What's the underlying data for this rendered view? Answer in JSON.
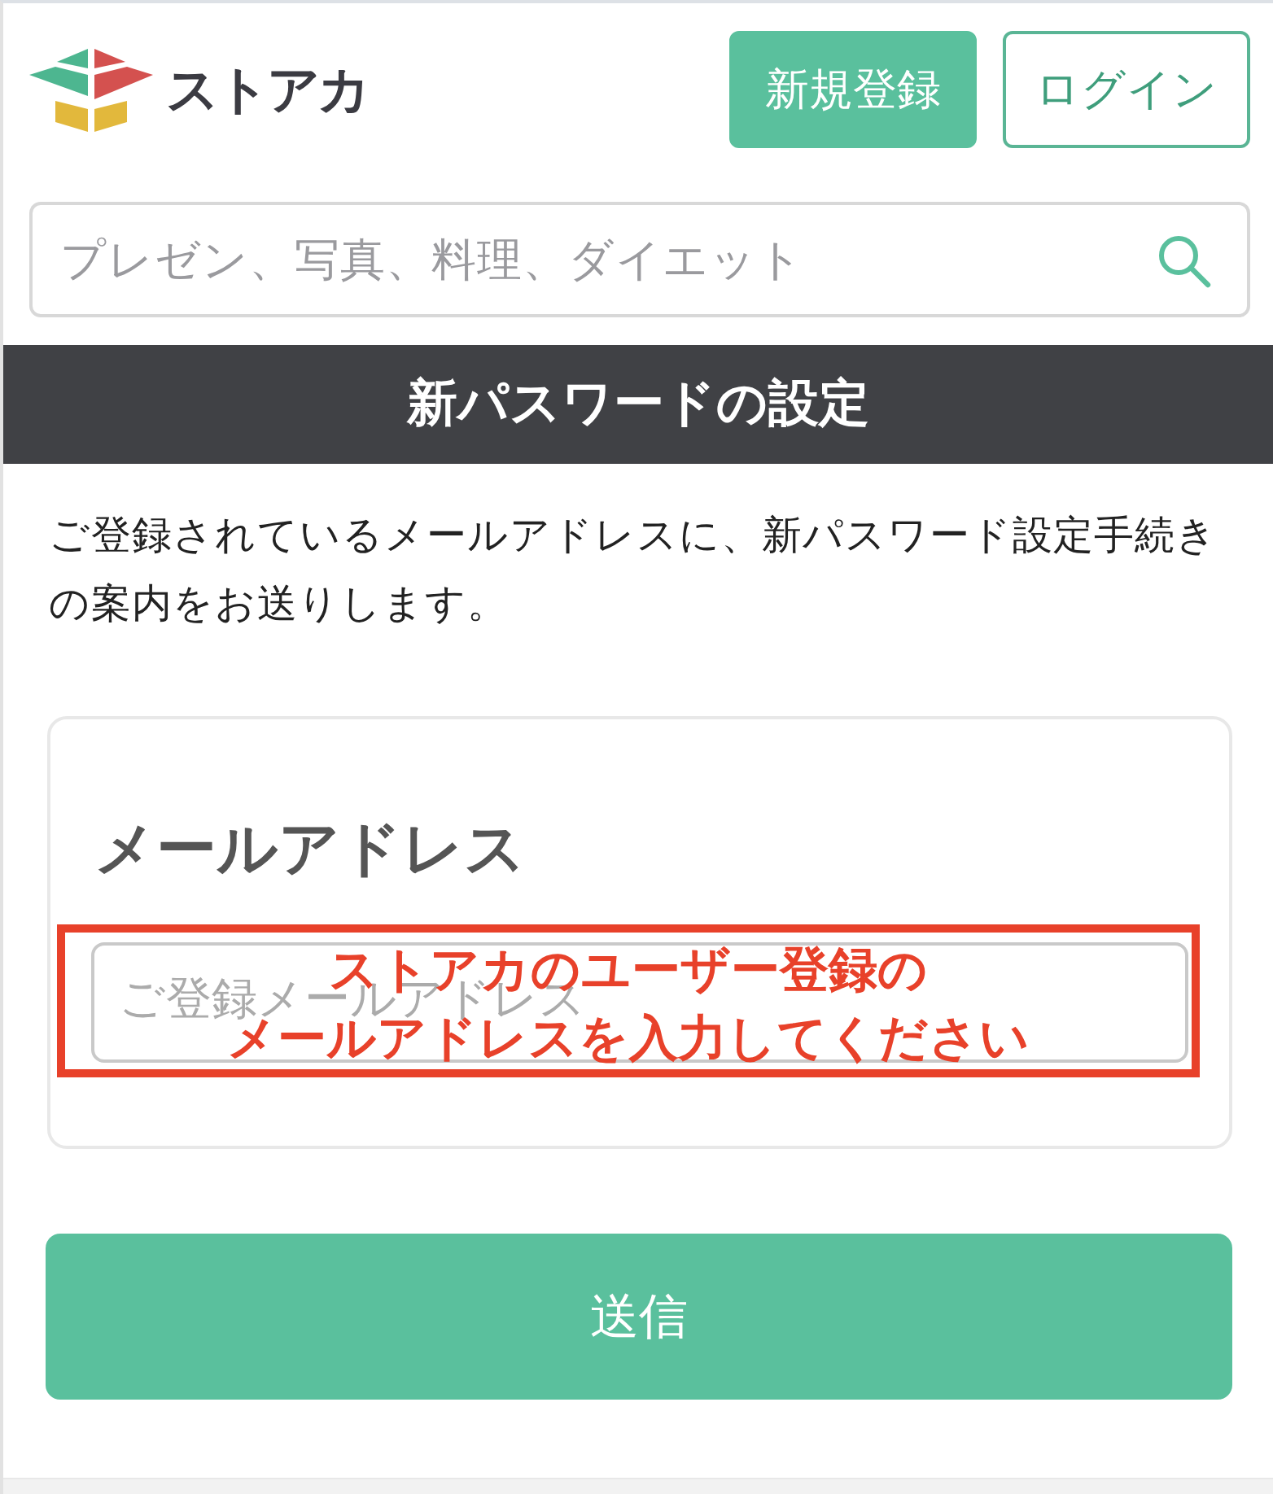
{
  "header": {
    "logo": {
      "text": "ストアカ"
    },
    "buttons": [
      {
        "label": "新規登録",
        "kind": "filled"
      },
      {
        "label": "ログイン",
        "kind": "outline"
      }
    ]
  },
  "search": {
    "placeholder": "プレゼン、写真、料理、ダイエット"
  },
  "page_title": "新パスワードの設定",
  "description": "ご登録されているメールアドレスに、新パスワード設定手続きの案内をお送りします。",
  "form": {
    "label": "メールアドレス",
    "email_field": {
      "placeholder": "ご登録メールアドレス"
    },
    "annotation": {
      "lines": [
        "ストアカのユーザー登録の",
        "メールアドレスを入力してください"
      ]
    }
  },
  "submit_button": {
    "label": "送信"
  }
}
